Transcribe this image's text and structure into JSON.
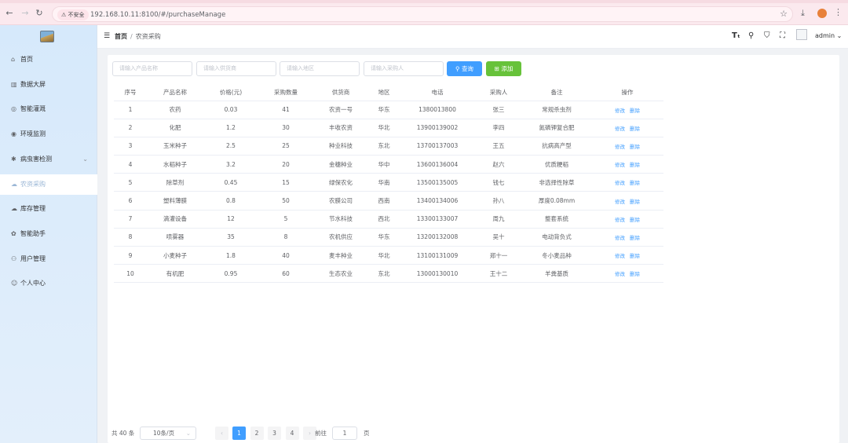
{
  "browser": {
    "security_label": "不安全",
    "url": "192.168.10.11:8100/#/purchaseManage"
  },
  "sidebar": {
    "items": [
      {
        "label": "首页",
        "icon": "home-icon",
        "glyph": "⌂"
      },
      {
        "label": "数据大屏",
        "icon": "bar-chart-icon",
        "glyph": "▥"
      },
      {
        "label": "智能灌溉",
        "icon": "irrigation-icon",
        "glyph": "◎"
      },
      {
        "label": "环境监测",
        "icon": "monitor-icon",
        "glyph": "◉"
      },
      {
        "label": "病虫害检测",
        "icon": "bug-icon",
        "glyph": "✱"
      },
      {
        "label": "农资采购",
        "icon": "cart-icon",
        "glyph": "☁"
      },
      {
        "label": "库存管理",
        "icon": "box-icon",
        "glyph": "☁"
      },
      {
        "label": "智能助手",
        "icon": "assistant-icon",
        "glyph": "✿"
      },
      {
        "label": "用户管理",
        "icon": "users-icon",
        "glyph": "⚇"
      },
      {
        "label": "个人中心",
        "icon": "user-icon",
        "glyph": "☺"
      }
    ],
    "active_index": 5
  },
  "header": {
    "breadcrumb_home": "首页",
    "breadcrumb_sep": "/",
    "breadcrumb_current": "农资采购",
    "username": "admin"
  },
  "search": {
    "product_placeholder": "请输入产品名称",
    "supplier_placeholder": "请输入供货商",
    "region_placeholder": "请输入地区",
    "buyer_placeholder": "请输入采购人",
    "query_label": "查询",
    "add_label": "添加"
  },
  "table": {
    "columns": [
      "序号",
      "产品名称",
      "价格(元)",
      "采购数量",
      "供货商",
      "地区",
      "电话",
      "采购人",
      "备注",
      "操作"
    ],
    "edit_label": "修改",
    "delete_label": "删除",
    "rows": [
      [
        "1",
        "农药",
        "0.03",
        "41",
        "农资一号",
        "华东",
        "1380013800",
        "张三",
        "常规杀虫剂"
      ],
      [
        "2",
        "化肥",
        "1.2",
        "30",
        "丰收农资",
        "华北",
        "13900139002",
        "李四",
        "氮磷钾复合肥"
      ],
      [
        "3",
        "玉米种子",
        "2.5",
        "25",
        "种业科技",
        "东北",
        "13700137003",
        "王五",
        "抗病高产型"
      ],
      [
        "4",
        "水稻种子",
        "3.2",
        "20",
        "金穗种业",
        "华中",
        "13600136004",
        "赵六",
        "优质粳稻"
      ],
      [
        "5",
        "除草剂",
        "0.45",
        "15",
        "绿保农化",
        "华南",
        "13500135005",
        "钱七",
        "非选择性除草"
      ],
      [
        "6",
        "塑料薄膜",
        "0.8",
        "50",
        "农膜公司",
        "西南",
        "13400134006",
        "孙八",
        "厚度0.08mm"
      ],
      [
        "7",
        "滴灌设备",
        "12",
        "5",
        "节水科技",
        "西北",
        "13300133007",
        "周九",
        "整套系统"
      ],
      [
        "8",
        "喷雾器",
        "35",
        "8",
        "农机供应",
        "华东",
        "13200132008",
        "吴十",
        "电动背负式"
      ],
      [
        "9",
        "小麦种子",
        "1.8",
        "40",
        "麦丰种业",
        "华北",
        "13100131009",
        "郑十一",
        "冬小麦品种"
      ],
      [
        "10",
        "有机肥",
        "0.95",
        "60",
        "生态农业",
        "东北",
        "13000130010",
        "王十二",
        "羊粪基质"
      ]
    ]
  },
  "pagination": {
    "total_text": "共 40 条",
    "page_size": "10条/页",
    "prev": "‹",
    "next": "›",
    "pages": [
      "1",
      "2",
      "3",
      "4"
    ],
    "current_page": "1",
    "goto_label": "前往",
    "goto_value": "1",
    "page_unit": "页"
  },
  "colors": {
    "primary": "#409eff",
    "success": "#67c23a",
    "sidebar_bg": "#d6e9fb",
    "active_text": "#9bb7d6"
  }
}
